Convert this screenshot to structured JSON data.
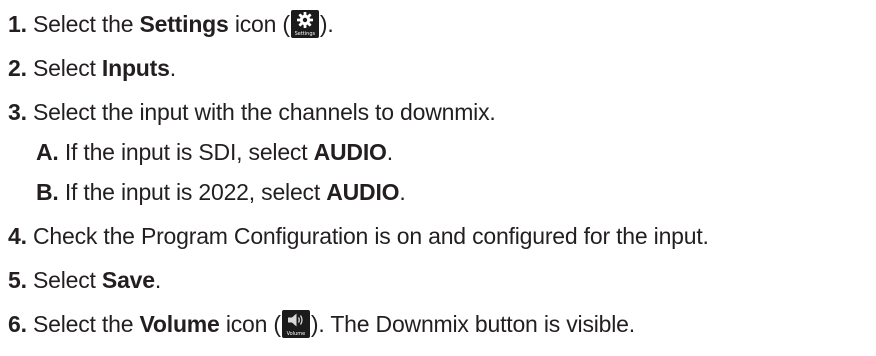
{
  "steps": [
    {
      "num": "1.",
      "pre": "Select the ",
      "bold": "Settings",
      "post_icon": " icon (",
      "icon": "settings-icon",
      "icon_caption": "Settings",
      "after_icon": ")."
    },
    {
      "num": "2.",
      "pre": "Select ",
      "bold": "Inputs",
      "post": "."
    },
    {
      "num": "3.",
      "text": "Select the input with the channels to downmix."
    },
    {
      "num": "A.",
      "pre": "If the input is SDI, select ",
      "bold": "AUDIO",
      "post": "."
    },
    {
      "num": "B.",
      "pre": "If the input is 2022, select ",
      "bold": "AUDIO",
      "post": "."
    },
    {
      "num": "4.",
      "text": "Check the Program Configuration is on and configured for the input."
    },
    {
      "num": "5.",
      "pre": "Select ",
      "bold": "Save",
      "post": "."
    },
    {
      "num": "6.",
      "pre": "Select the ",
      "bold": "Volume",
      "post_icon": " icon (",
      "icon": "volume-icon",
      "icon_caption": "Volume",
      "after_icon": "). The Downmix button is visible."
    }
  ]
}
